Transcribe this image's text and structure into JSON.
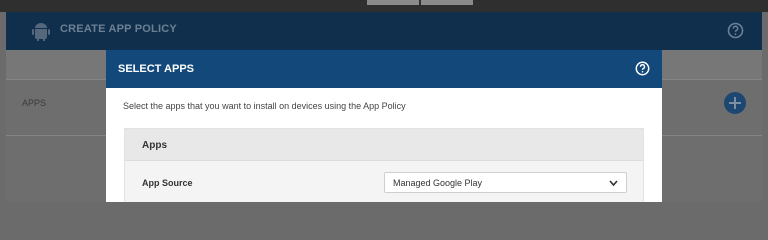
{
  "page": {
    "title": "CREATE APP POLICY",
    "apps_label": "APPS"
  },
  "modal": {
    "title": "SELECT APPS",
    "description": "Select the apps that you want to install on devices using the App Policy",
    "card_title": "Apps",
    "app_source_label": "App Source",
    "app_source_value": "Managed Google Play"
  },
  "icons": {
    "logo": "android-icon",
    "help": "question-circle-icon",
    "add": "plus-circle-icon",
    "dropdown": "chevron-down-icon"
  },
  "colors": {
    "modal_header": "#12497a",
    "page_header": "#0f2f4c"
  }
}
